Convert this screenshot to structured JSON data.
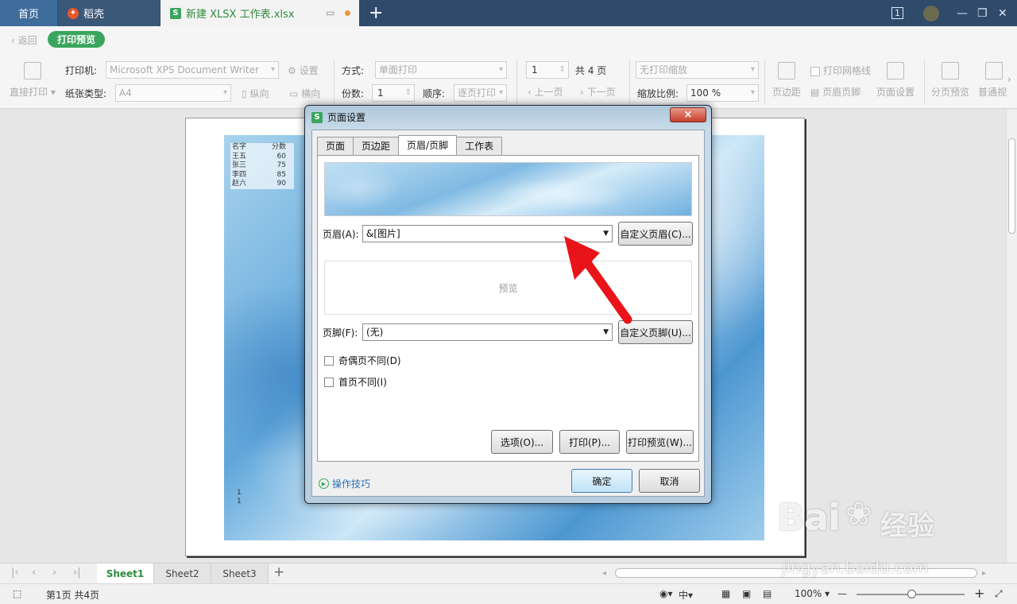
{
  "titlebar": {
    "tabs": [
      {
        "label": "首页"
      },
      {
        "label": "稻壳"
      },
      {
        "label": "新建 XLSX 工作表.xlsx"
      }
    ],
    "page_indicator": "1"
  },
  "subbar": {
    "back_label": "返回",
    "mode_label": "打印预览"
  },
  "toolbar": {
    "direct_print": "直接打印",
    "printer_label": "打印机:",
    "printer_value": "Microsoft XPS Document Writer",
    "settings": "设置",
    "paper_label": "纸张类型:",
    "paper_value": "A4",
    "portrait": "纵向",
    "landscape": "横向",
    "method_label": "方式:",
    "method_value": "单面打印",
    "copies_label": "份数:",
    "copies_value": "1",
    "order_label": "顺序:",
    "order_value": "逐页打印",
    "page_value": "1",
    "total_pages": "共 4 页",
    "prev_page": "上一页",
    "next_page": "下一页",
    "scale_mode": "无打印缩放",
    "scale_label": "缩放比例:",
    "scale_value": "100 %",
    "margins": "页边距",
    "print_grid": "打印网格线",
    "header_footer": "页眉页脚",
    "page_setup": "页面设置",
    "page_break_preview": "分页预览",
    "normal_view": "普通视"
  },
  "sheet": {
    "header": [
      "名字",
      "分数"
    ],
    "rows": [
      [
        "王五",
        "60"
      ],
      [
        "张三",
        "75"
      ],
      [
        "李四",
        "85"
      ],
      [
        "赵六",
        "90"
      ]
    ],
    "footer_lines": [
      "1",
      "1"
    ]
  },
  "dialog": {
    "title": "页面设置",
    "close": "×",
    "tabs": [
      "页面",
      "页边距",
      "页眉/页脚",
      "工作表"
    ],
    "header_label": "页眉(A):",
    "header_value": "&[图片]",
    "custom_header": "自定义页眉(C)...",
    "preview_text": "预览",
    "footer_label": "页脚(F):",
    "footer_value": "(无)",
    "custom_footer": "自定义页脚(U)...",
    "odd_even": "奇偶页不同(D)",
    "first_page": "首页不同(I)",
    "options": "选项(O)...",
    "print": "打印(P)...",
    "print_preview": "打印预览(W)...",
    "tips": "操作技巧",
    "ok": "确定",
    "cancel": "取消"
  },
  "sheetbar": {
    "tabs": [
      "Sheet1",
      "Sheet2",
      "Sheet3"
    ],
    "add": "+"
  },
  "statusbar": {
    "page_info": "第1页 共4页",
    "zoom": "100%"
  },
  "watermark": {
    "brand": "Bai",
    "cn": "经验",
    "url": "jingyan.baidu.com"
  },
  "colors": {
    "accent_green": "#3aa55d",
    "titlebar": "#2f4a6b",
    "arrow": "#e8141a"
  }
}
